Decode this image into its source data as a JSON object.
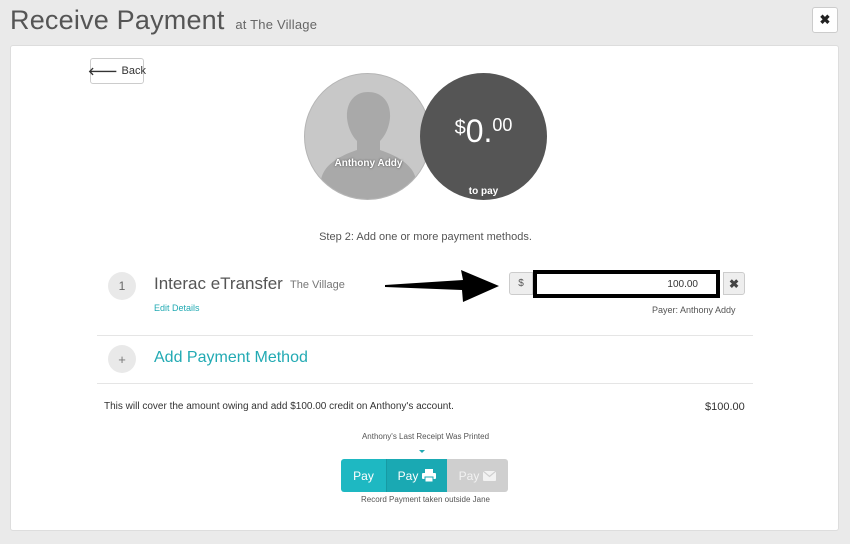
{
  "header": {
    "title": "Receive Payment",
    "subtitle": "at The Village",
    "close_label": "✖"
  },
  "back_button": {
    "label": "Back"
  },
  "patient": {
    "name": "Anthony Addy"
  },
  "to_pay": {
    "currency": "$",
    "integer": "0",
    "separator": ".",
    "decimals": "00",
    "label": "to pay"
  },
  "step_text": "Step 2: Add one or more payment methods.",
  "payment_methods": [
    {
      "index": "1",
      "name": "Interac eTransfer",
      "clinic": "The Village",
      "edit_label": "Edit Details",
      "currency_symbol": "$",
      "amount": "100.00",
      "remove_label": "✖",
      "payer": "Payer: Anthony Addy"
    }
  ],
  "add_method": {
    "icon_label": "+",
    "label": "Add Payment Method"
  },
  "summary": {
    "text": "This will cover the amount owing and add $100.00 credit on Anthony's account.",
    "amount": "$100.00"
  },
  "receipt_note": "Anthony's Last Receipt Was Printed",
  "pay_buttons": {
    "pay": "Pay",
    "pay_print": "Pay",
    "pay_email": "Pay"
  },
  "record_note": "Record Payment taken outside Jane",
  "colors": {
    "accent": "#1eb8c2",
    "dark_circle": "#555555",
    "disabled": "#cfcfcf"
  }
}
